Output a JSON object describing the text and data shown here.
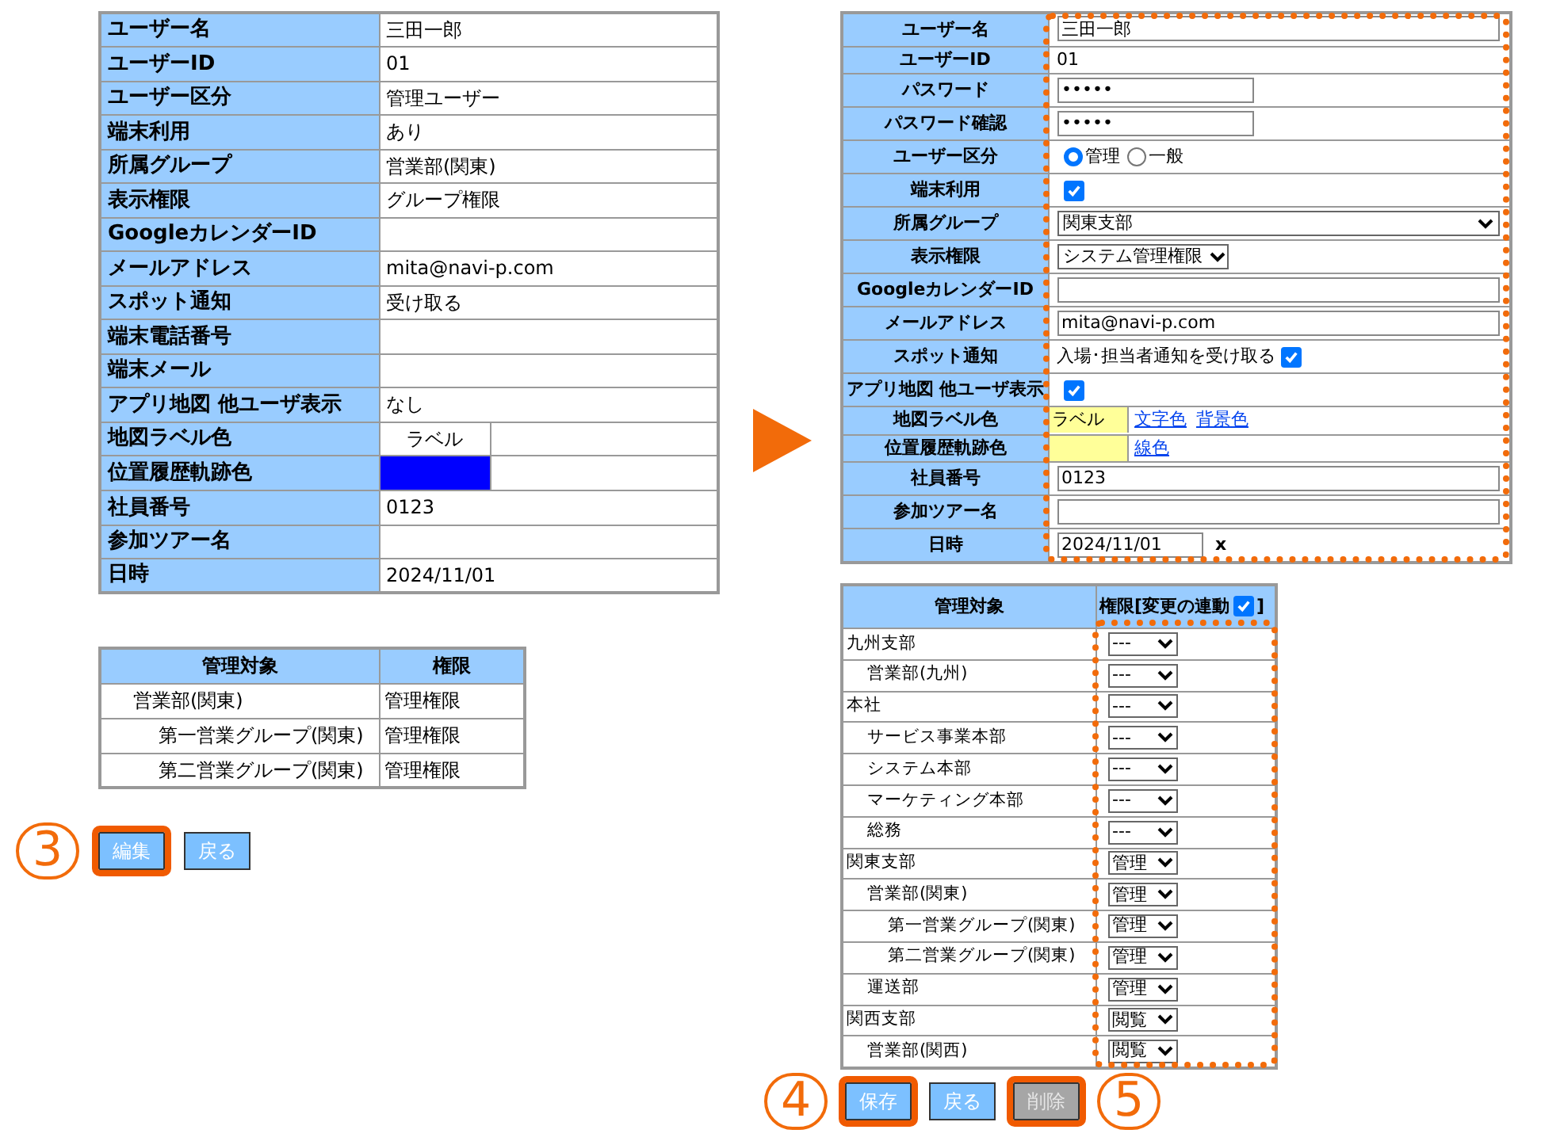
{
  "detail_table": {
    "rows": [
      {
        "label": "ユーザー名",
        "kind": "text",
        "value": "三田一郎"
      },
      {
        "label": "ユーザーID",
        "kind": "text",
        "value": "01"
      },
      {
        "label": "ユーザー区分",
        "kind": "text",
        "value": "管理ユーザー"
      },
      {
        "label": "端末利用",
        "kind": "text",
        "value": "あり"
      },
      {
        "label": "所属グループ",
        "kind": "text",
        "value": "営業部(関東)"
      },
      {
        "label": "表示権限",
        "kind": "text",
        "value": "グループ権限"
      },
      {
        "label": "GoogleカレンダーID",
        "kind": "text"
      },
      {
        "label": "メールアドレス",
        "kind": "text",
        "value": "mita@navi-p.com"
      },
      {
        "label": "スポット通知",
        "kind": "text",
        "value": "受け取る"
      },
      {
        "label": "端末電話番号",
        "kind": "text"
      },
      {
        "label": "端末メール",
        "kind": "text"
      },
      {
        "label": "アプリ地図 他ユーザ表示",
        "kind": "text",
        "value": "なし"
      },
      {
        "label": "地図ラベル色",
        "kind": "label_sample",
        "value": "ラベル"
      },
      {
        "label": "位置履歴軌跡色",
        "kind": "swatch",
        "color": "#0000ff"
      },
      {
        "label": "社員番号",
        "kind": "text",
        "value": "0123"
      },
      {
        "label": "参加ツアー名",
        "kind": "text"
      },
      {
        "label": "日時",
        "kind": "text",
        "value": "2024/11/01"
      }
    ]
  },
  "group_table": {
    "columns": [
      "管理対象",
      "権限"
    ],
    "rows": [
      {
        "target": "営業部(関東)",
        "permission": "管理権限",
        "children": [
          {
            "target": "第一営業グループ(関東)",
            "permission": "管理権限"
          },
          {
            "target": "第二営業グループ(関東)",
            "permission": "管理権限"
          }
        ]
      }
    ]
  },
  "left_actions": {
    "callout": "3",
    "buttons": [
      {
        "label": "編集",
        "highlighted": true,
        "disabled": false
      },
      {
        "label": "戻る",
        "highlighted": false,
        "disabled": false
      }
    ]
  },
  "edit_form": {
    "highlighted": true,
    "rows": [
      {
        "label": "ユーザー名",
        "kind": "text",
        "value": "三田一郎"
      },
      {
        "label": "ユーザーID",
        "kind": "static",
        "value": "01"
      },
      {
        "label": "パスワード",
        "kind": "password",
        "value": "•••••"
      },
      {
        "label": "パスワード確認",
        "kind": "password",
        "value": "•••••"
      },
      {
        "label": "ユーザー区分",
        "kind": "radio",
        "options": [
          {
            "label": "管理",
            "selected": true
          },
          {
            "label": "一般",
            "selected": false
          }
        ]
      },
      {
        "label": "端末利用",
        "kind": "checkbox",
        "checked": true
      },
      {
        "label": "所属グループ",
        "kind": "select",
        "value": "関東支部",
        "wide": true
      },
      {
        "label": "表示権限",
        "kind": "select",
        "value": "システム管理権限",
        "wide": false
      },
      {
        "label": "GoogleカレンダーID",
        "kind": "text"
      },
      {
        "label": "メールアドレス",
        "kind": "text",
        "value": "mita@navi-p.com"
      },
      {
        "label": "スポット通知",
        "kind": "checkbox_label",
        "text": "入場･担当者通知を受け取る",
        "checked": true
      },
      {
        "label": "アプリ地図 他ユーザ表示",
        "kind": "checkbox",
        "checked": true
      },
      {
        "label": "地図ラベル色",
        "kind": "color_links",
        "sample": "ラベル",
        "color": "#ffff99",
        "links": [
          "文字色",
          "背景色"
        ]
      },
      {
        "label": "位置履歴軌跡色",
        "kind": "color_links",
        "color": "#ffff99",
        "links": [
          "線色"
        ]
      },
      {
        "label": "社員番号",
        "kind": "text",
        "value": "0123"
      },
      {
        "label": "参加ツアー名",
        "kind": "text"
      },
      {
        "label": "日時",
        "kind": "date",
        "value": "2024/11/01",
        "clear": "x"
      }
    ]
  },
  "permission_table": {
    "highlighted": true,
    "columns": [
      {
        "label": "管理対象"
      },
      {
        "label": "権限[変更の連動",
        "linked": true,
        "suffix": "]"
      }
    ],
    "rows": [
      {
        "target": "九州支部",
        "permission": "---",
        "children": [
          {
            "target": "営業部(九州)",
            "permission": "---"
          }
        ]
      },
      {
        "target": "本社",
        "permission": "---",
        "children": [
          {
            "target": "サービス事業本部",
            "permission": "---"
          },
          {
            "target": "システム本部",
            "permission": "---"
          },
          {
            "target": "マーケティング本部",
            "permission": "---"
          },
          {
            "target": "総務",
            "permission": "---"
          }
        ]
      },
      {
        "target": "関東支部",
        "permission": "管理",
        "children": [
          {
            "target": "営業部(関東)",
            "permission": "管理",
            "children": [
              {
                "target": "第一営業グループ(関東)",
                "permission": "管理"
              },
              {
                "target": "第二営業グループ(関東)",
                "permission": "管理"
              }
            ]
          },
          {
            "target": "運送部",
            "permission": "管理"
          }
        ]
      },
      {
        "target": "関西支部",
        "permission": "閲覧",
        "children": [
          {
            "target": "営業部(関西)",
            "permission": "閲覧"
          }
        ]
      }
    ]
  },
  "right_actions": {
    "callouts": [
      "4",
      "5"
    ],
    "buttons": [
      {
        "label": "保存",
        "highlighted": true,
        "disabled": false
      },
      {
        "label": "戻る",
        "highlighted": false,
        "disabled": false
      },
      {
        "label": "削除",
        "highlighted": true,
        "disabled": true
      }
    ]
  }
}
